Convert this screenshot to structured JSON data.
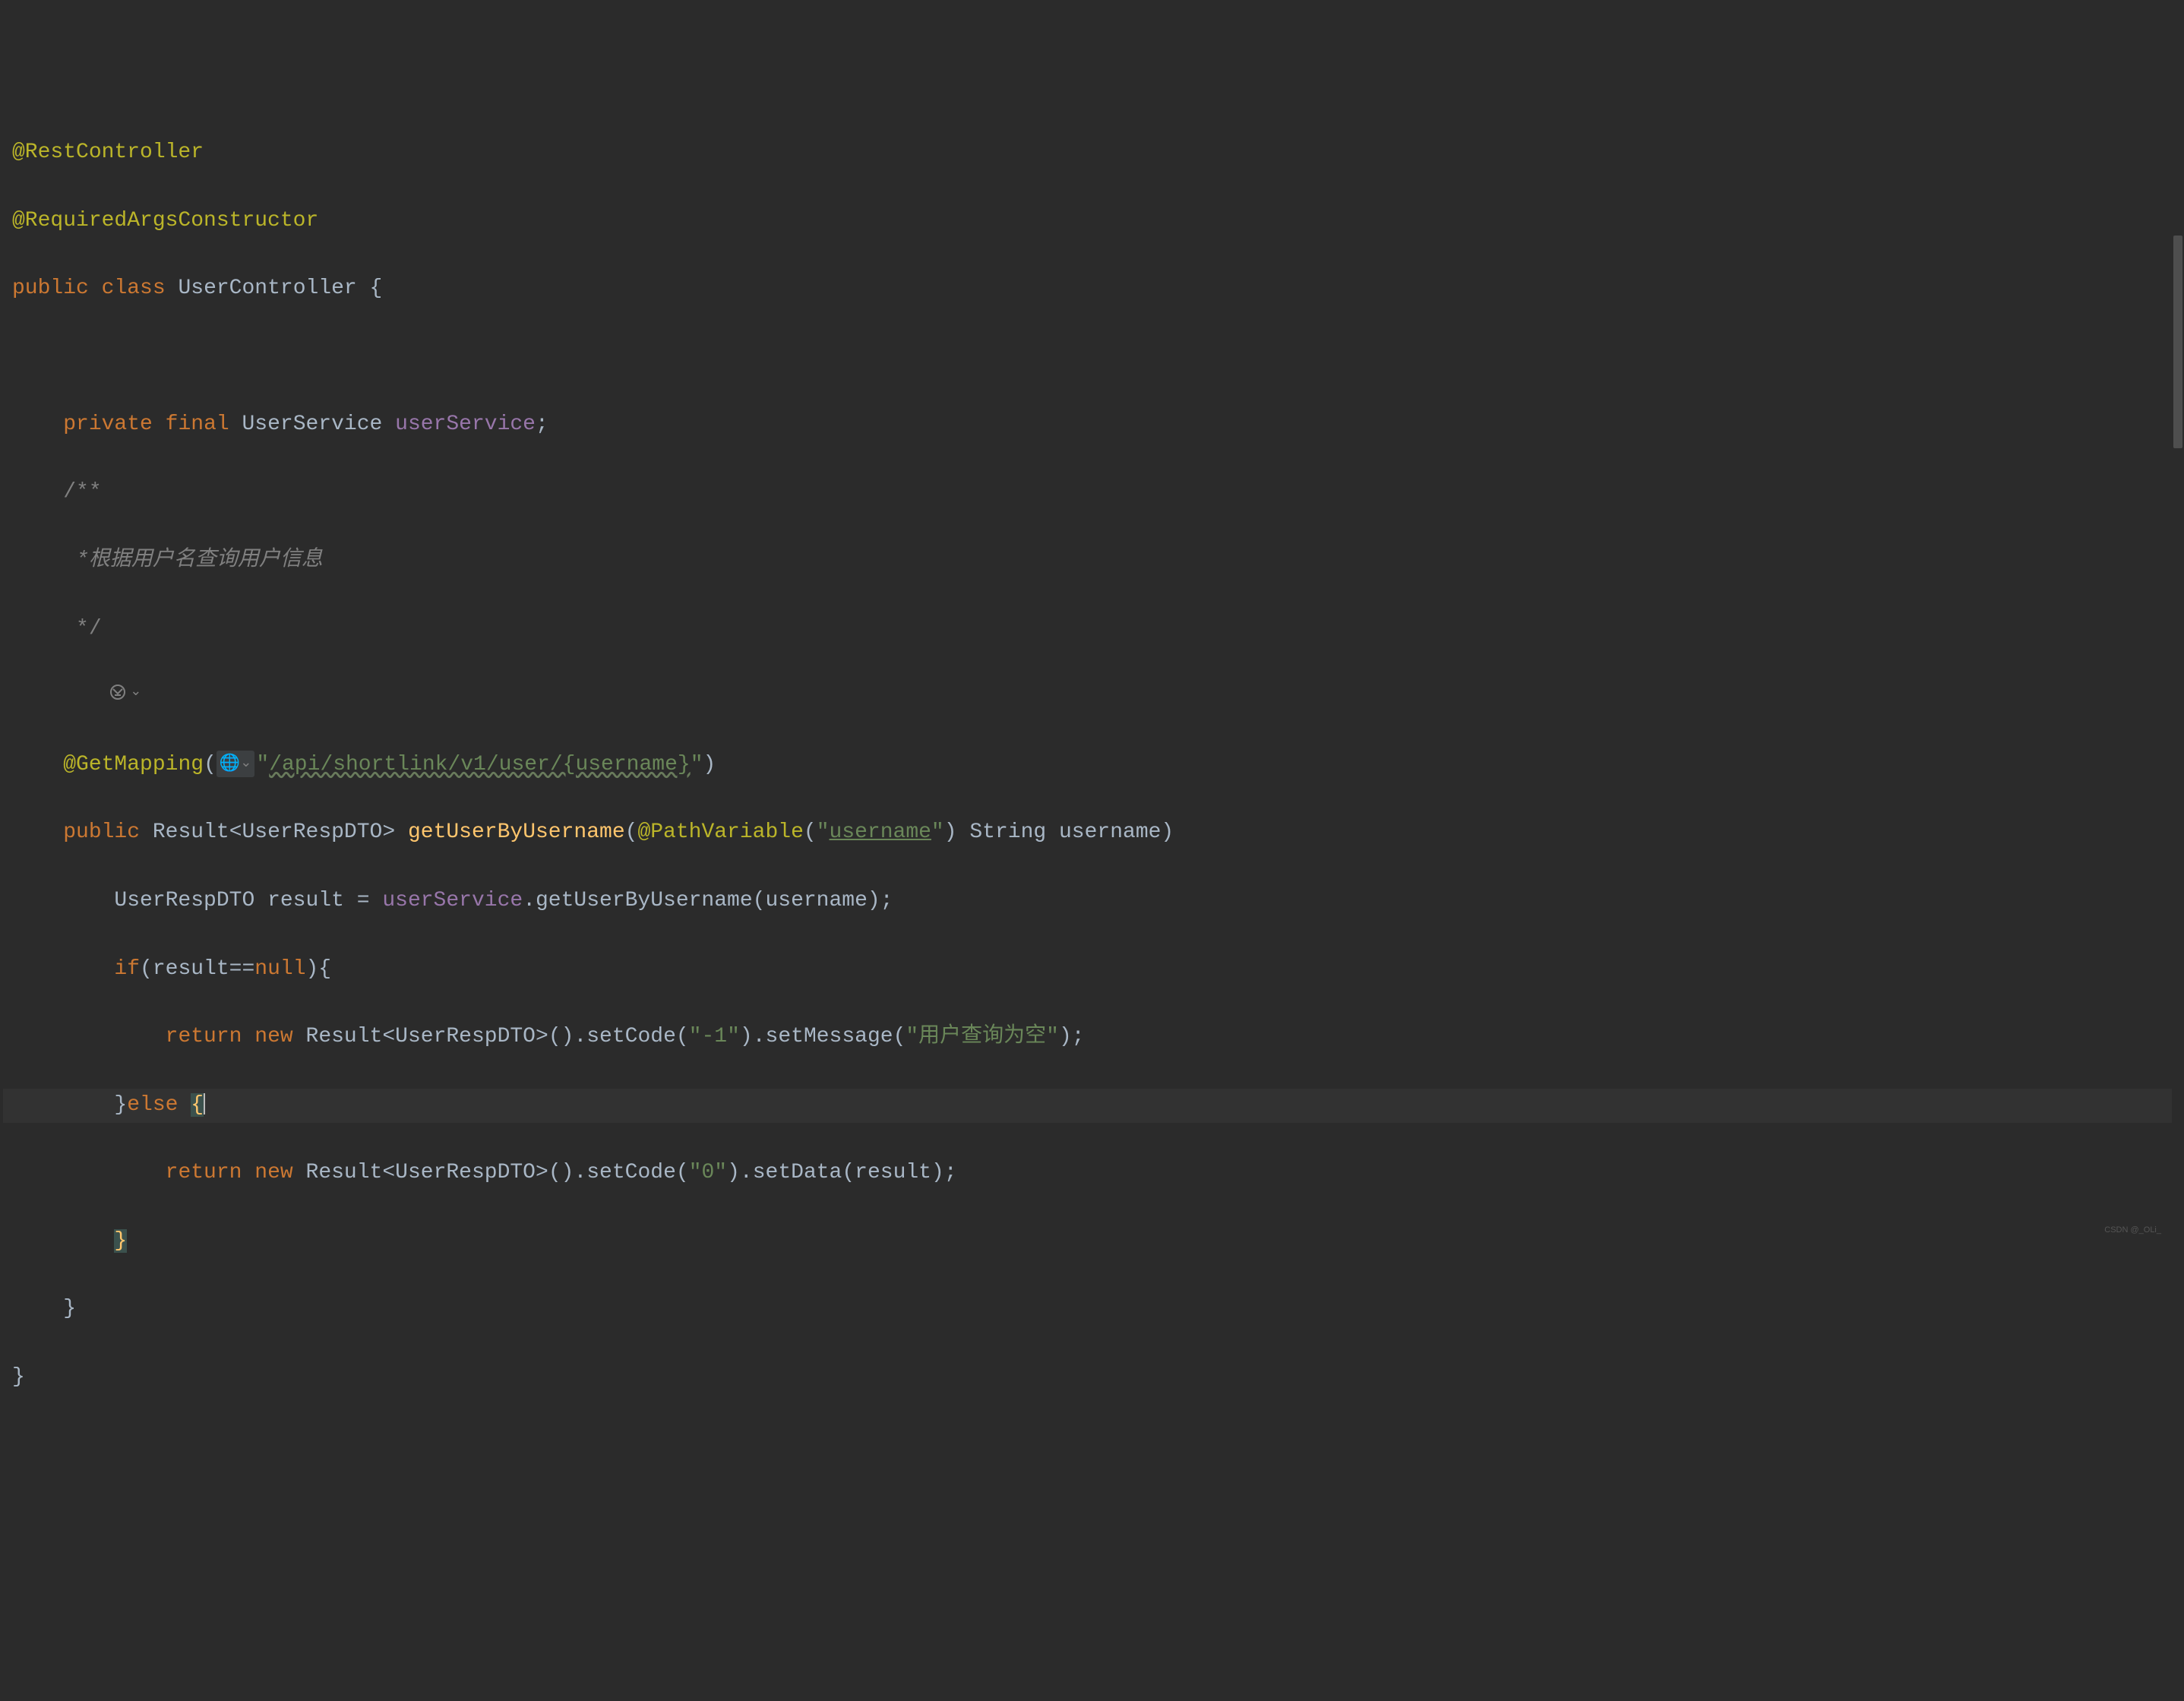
{
  "code": {
    "annotations": {
      "restController": "@RestController",
      "requiredArgsConstructor": "@RequiredArgsConstructor",
      "getMapping": "@GetMapping",
      "pathVariable": "@PathVariable"
    },
    "keywords": {
      "public": "public",
      "class": "class",
      "private": "private",
      "final": "final",
      "if": "if",
      "else": "else",
      "return": "return",
      "new": "new",
      "null": "null"
    },
    "identifiers": {
      "userController": "UserController",
      "userService": "UserService",
      "userServiceField": "userService",
      "result": "Result",
      "userRespDTO": "UserRespDTO",
      "getUserByUsername": "getUserByUsername",
      "string": "String",
      "username": "username",
      "resultVar": "result",
      "setCode": "setCode",
      "setMessage": "setMessage",
      "setData": "setData"
    },
    "strings": {
      "apiPath": "\"/api/shortlink/v1/user/{username}\"",
      "apiPathInner": "/api/shortlink/v1/user/{username}",
      "usernameParam": "\"username\"",
      "usernameParamInner": "username",
      "codeNeg1": "\"-1\"",
      "code0": "\"0\"",
      "emptyMsg": "\"用户查询为空\""
    },
    "comments": {
      "open": "/**",
      "line1": " *根据用户名查询用户信息",
      "close": " */"
    },
    "punct": {
      "openBrace": "{",
      "closeBrace": "}",
      "semicolon": ";",
      "openParen": "(",
      "closeParen": ")",
      "lt": "<",
      "gt": ">",
      "dot": ".",
      "eq": "=",
      "eqeq": "==",
      "closeParenBrace": "){"
    }
  },
  "watermark": "CSDN @_OLi_"
}
